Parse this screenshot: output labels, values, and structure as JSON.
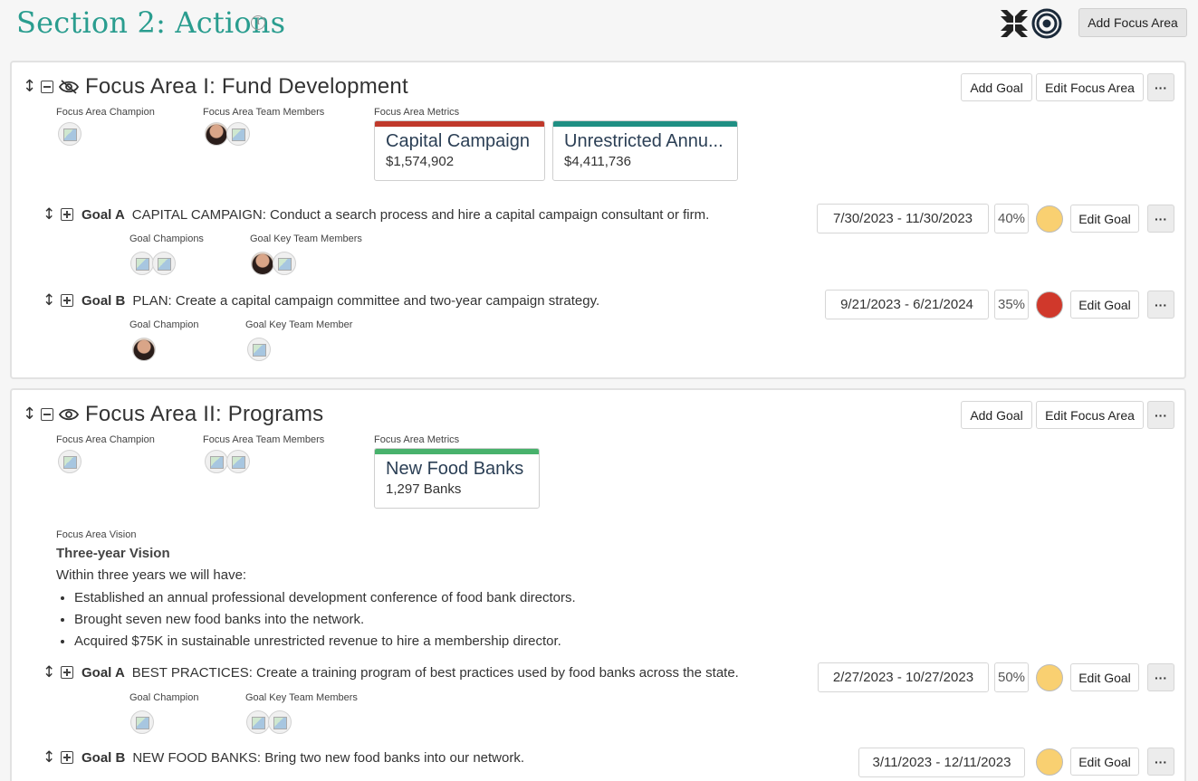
{
  "header": {
    "title": "Section 2: Actions",
    "info_icon": "i",
    "add_focus_area": "Add Focus Area"
  },
  "focus_areas": [
    {
      "title": "Focus Area I: Fund Development",
      "visibility_icon": "eye-off",
      "add_goal": "Add Goal",
      "edit_focus_area": "Edit Focus Area",
      "more": "···",
      "champion_label": "Focus Area Champion",
      "team_label": "Focus Area Team Members",
      "metrics_label": "Focus Area Metrics",
      "metrics": [
        {
          "name": "Capital Campaign",
          "value": "$1,574,902",
          "color": "#c0392b"
        },
        {
          "name": "Unrestricted Annu...",
          "value": "$4,411,736",
          "color": "#1f8f83"
        }
      ],
      "goals": [
        {
          "label": "Goal A",
          "text": "CAPITAL CAMPAIGN: Conduct a search process and hire a capital campaign consultant or firm.",
          "dates": "7/30/2023 - 11/30/2023",
          "percent": "40%",
          "status_color": "#f9d071",
          "champions_label": "Goal Champions",
          "team_label": "Goal Key Team Members",
          "edit": "Edit Goal",
          "more": "···"
        },
        {
          "label": "Goal B",
          "text": "PLAN: Create a capital campaign committee and two-year campaign strategy.",
          "dates": "9/21/2023 - 6/21/2024",
          "percent": "35%",
          "status_color": "#d0382b",
          "champions_label": "Goal Champion",
          "team_label": "Goal Key Team Member",
          "edit": "Edit Goal",
          "more": "···"
        }
      ]
    },
    {
      "title": "Focus Area II: Programs",
      "visibility_icon": "eye",
      "add_goal": "Add Goal",
      "edit_focus_area": "Edit Focus Area",
      "more": "···",
      "champion_label": "Focus Area Champion",
      "team_label": "Focus Area Team Members",
      "metrics_label": "Focus Area Metrics",
      "metrics": [
        {
          "name": "New Food Banks",
          "value": "1,297 Banks",
          "color": "#48b26c"
        }
      ],
      "vision": {
        "label": "Focus Area Vision",
        "title": "Three-year Vision",
        "intro": "Within three years we will have:",
        "items": [
          "Established an annual professional development conference of food bank directors.",
          "Brought seven new food banks into the network.",
          "Acquired $75K in sustainable unrestricted revenue to hire a membership director."
        ]
      },
      "goals": [
        {
          "label": "Goal A",
          "text": "BEST PRACTICES: Create a training program of best practices used by food banks across the state.",
          "dates": "2/27/2023 - 10/27/2023",
          "percent": "50%",
          "status_color": "#f9d071",
          "champions_label": "Goal Champion",
          "team_label": "Goal Key Team Members",
          "edit": "Edit Goal",
          "more": "···"
        },
        {
          "label": "Goal B",
          "text": "NEW FOOD BANKS: Bring two new food banks into our network.",
          "dates": "3/11/2023 - 12/11/2023",
          "status_color": "#f9d071",
          "edit": "Edit Goal",
          "more": "···"
        }
      ]
    }
  ],
  "icons": {
    "drag": "↕"
  }
}
